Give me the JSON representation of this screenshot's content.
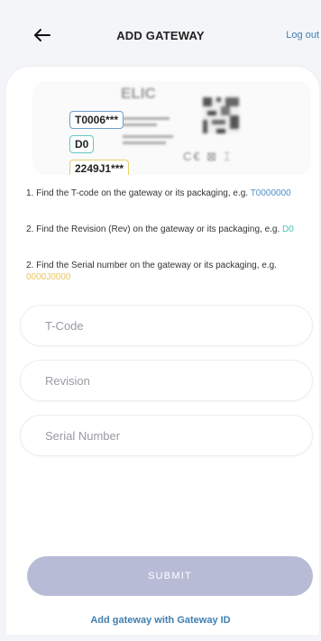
{
  "header": {
    "title": "ADD GATEWAY",
    "logout_label": "Log out"
  },
  "label_image": {
    "tag_tcode": "T0006***",
    "tag_revision": "D0",
    "tag_serial": "2249J1***",
    "brand_text": "ELIC"
  },
  "instructions": [
    {
      "text": "1. Find the T-code on the gateway or its packaging, e.g. ",
      "example": "T0000000"
    },
    {
      "text": "2. Find the Revision (Rev) on the gateway or its packaging, e.g. ",
      "example": "D0"
    },
    {
      "text": "2. Find the Serial number on the gateway or its packaging, e.g. ",
      "example": "0000J0000"
    }
  ],
  "form": {
    "tcode_placeholder": "T-Code",
    "revision_placeholder": "Revision",
    "serial_placeholder": "Serial Number",
    "submit_label": "SUBMIT"
  },
  "alt_link_label": "Add gateway with Gateway ID",
  "colors": {
    "accent_link": "#3f7fb0",
    "submit_disabled": "#b8bbd6",
    "tcode_highlight": "#4e8fc9",
    "revision_highlight": "#4dc3b9",
    "serial_highlight": "#e8c55d"
  }
}
